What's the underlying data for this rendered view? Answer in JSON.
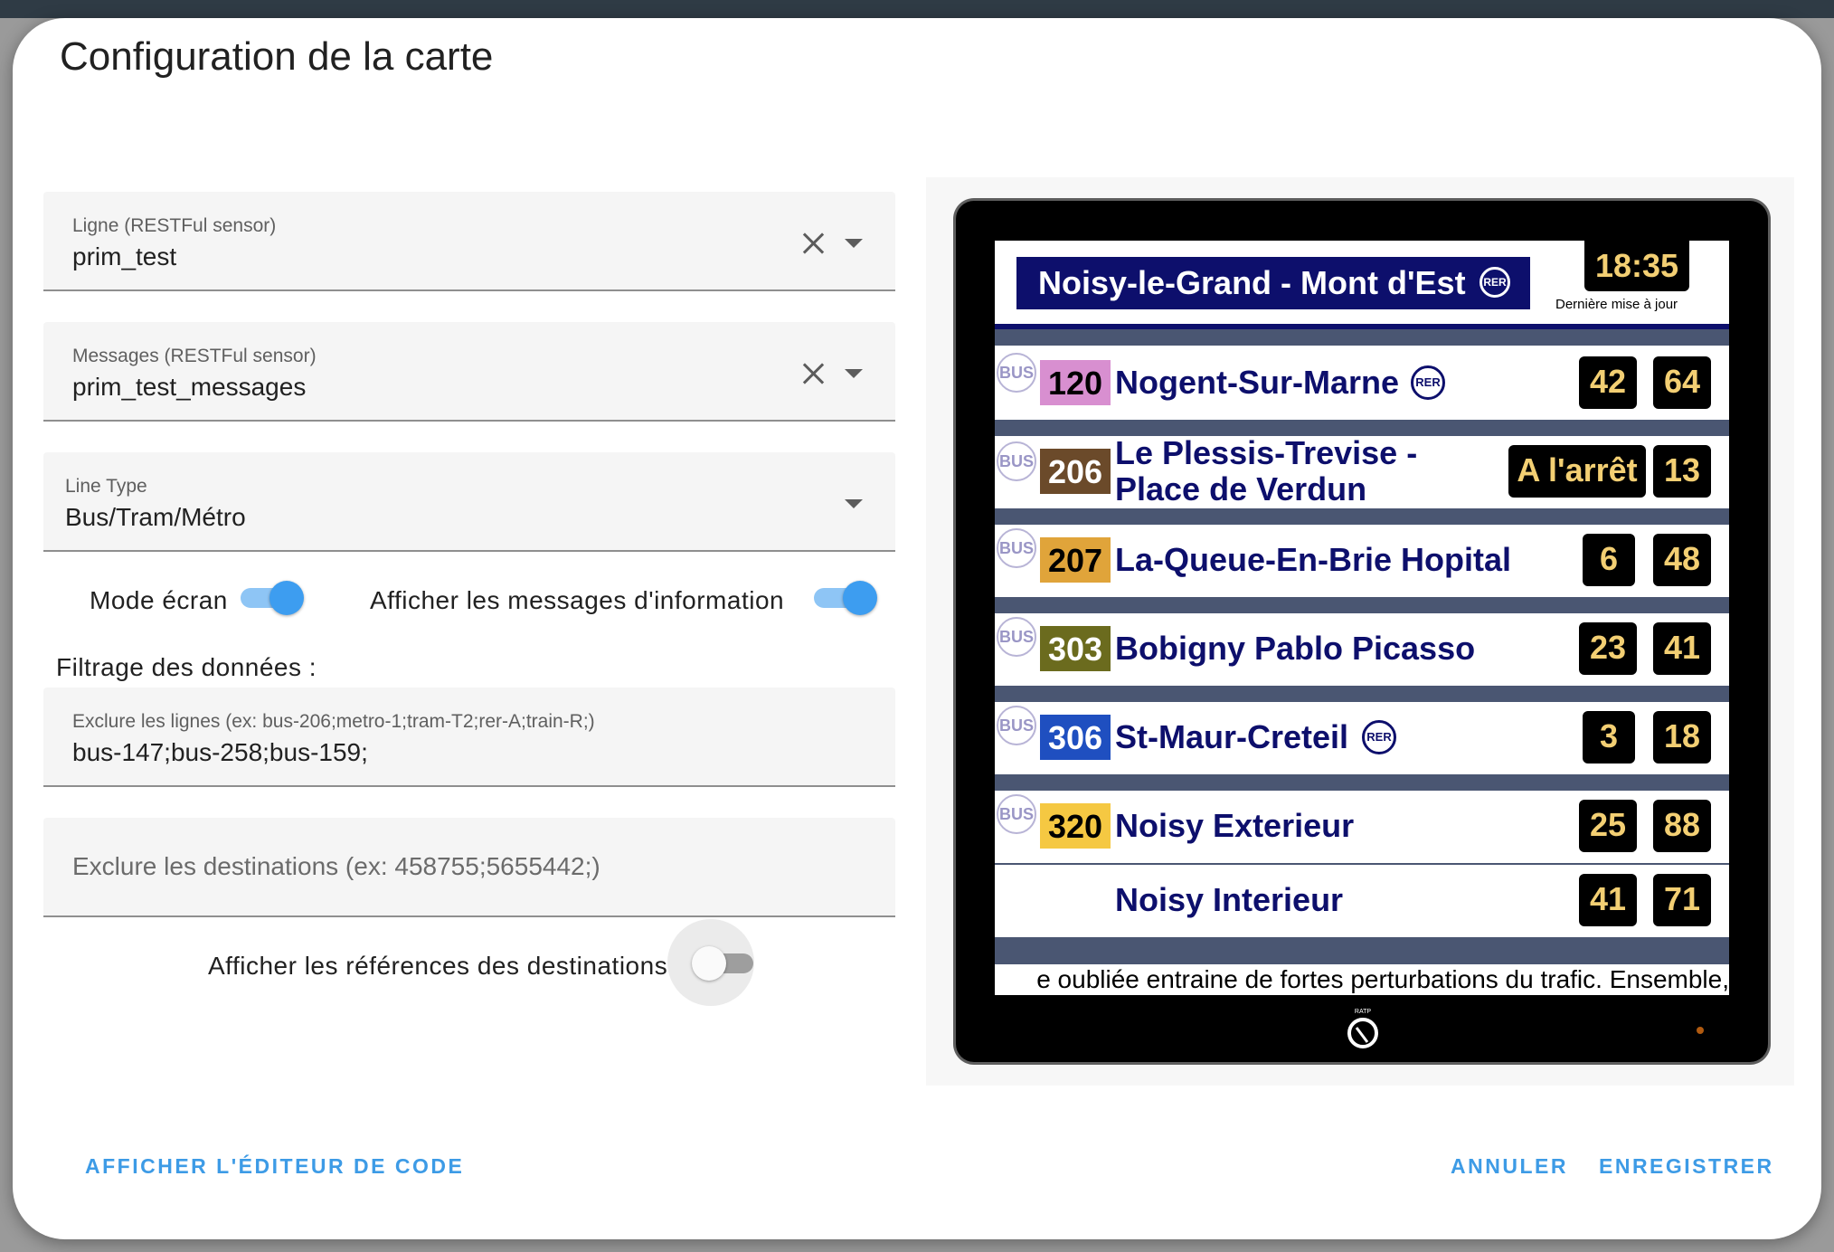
{
  "dialog": {
    "title": "Configuration de la carte",
    "fields": {
      "ligne": {
        "label": "Ligne (RESTFul sensor)",
        "value": "prim_test"
      },
      "messages": {
        "label": "Messages (RESTFul sensor)",
        "value": "prim_test_messages"
      },
      "line_type": {
        "label": "Line Type",
        "value": "Bus/Tram/Métro"
      }
    },
    "toggles": {
      "mode_ecran": {
        "label": "Mode écran",
        "state": true
      },
      "afficher_messages": {
        "label": "Afficher les messages d'information",
        "state": true
      },
      "afficher_references": {
        "label": "Afficher les références des destinations",
        "state": false
      }
    },
    "filtrage": {
      "heading": "Filtrage des données :",
      "exclure_lignes": {
        "label": "Exclure les lignes (ex: bus-206;metro-1;tram-T2;rer-A;train-R;)",
        "value": "bus-147;bus-258;bus-159;"
      },
      "exclure_destinations": {
        "placeholder": "Exclure les destinations (ex: 458755;5655442;)"
      }
    },
    "buttons": {
      "code_editor": "AFFICHER L'ÉDITEUR DE CODE",
      "cancel": "ANNULER",
      "save": "ENREGISTRER"
    }
  },
  "preview": {
    "stop_name": "Noisy-le-Grand - Mont d'Est",
    "stop_badge": "RER",
    "clock": "18:35",
    "last_update": "Dernière mise à jour",
    "bus_badge": "BUS",
    "rer_badge": "RER",
    "rows": [
      {
        "line": "120",
        "line_color": "#d88fd0",
        "line_text_color": "#000000",
        "dest": "Nogent-Sur-Marne",
        "rer": true,
        "t1": "42",
        "t2": "64"
      },
      {
        "line": "206",
        "line_color": "#6b4a2a",
        "line_text_color": "#ffffff",
        "dest1": "Le Plessis-Trevise -",
        "dest2": "Place de Verdun",
        "t1": "A l'arrêt",
        "t2": "13"
      },
      {
        "line": "207",
        "line_color": "#e0a43a",
        "line_text_color": "#000000",
        "dest": "La-Queue-En-Brie Hopital",
        "t1": "6",
        "t2": "48"
      },
      {
        "line": "303",
        "line_color": "#6b6b1e",
        "line_text_color": "#ffffff",
        "dest": "Bobigny Pablo Picasso",
        "t1": "23",
        "t2": "41"
      },
      {
        "line": "306",
        "line_color": "#1f4fc0",
        "line_text_color": "#ffffff",
        "dest": "St-Maur-Creteil",
        "rer": true,
        "t1": "3",
        "t2": "18"
      },
      {
        "line": "320",
        "line_color": "#f5c842",
        "line_text_color": "#000000",
        "dest": "Noisy Exterieur",
        "t1": "25",
        "t2": "88"
      },
      {
        "dest": "Noisy Interieur",
        "t1": "41",
        "t2": "71"
      }
    ],
    "ticker": "e oubliée entraine de fortes perturbations du trafic. Ensemble,",
    "logo_text": "RATP"
  }
}
